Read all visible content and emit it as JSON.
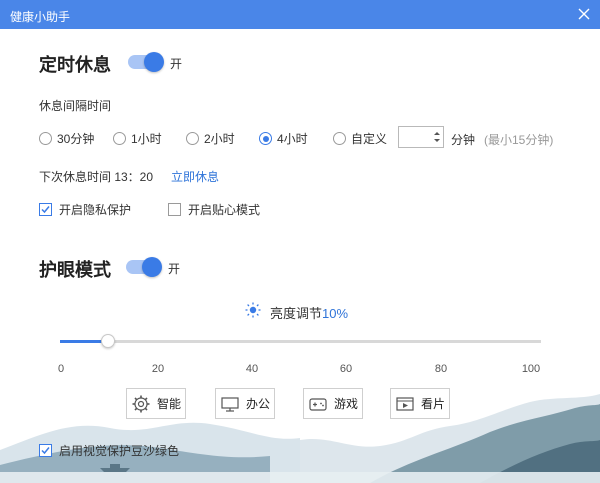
{
  "window": {
    "title": "健康小助手",
    "close_icon": "close-icon"
  },
  "timer": {
    "title": "定时休息",
    "toggle_state": "开",
    "toggle_on": true,
    "interval_label": "休息间隔时间",
    "options": [
      {
        "label": "30分钟",
        "checked": false
      },
      {
        "label": "1小时",
        "checked": false
      },
      {
        "label": "2小时",
        "checked": false
      },
      {
        "label": "4小时",
        "checked": true
      },
      {
        "label": "自定义",
        "checked": false
      }
    ],
    "custom_value": "",
    "custom_unit": "分钟",
    "custom_hint": "(最小15分钟)",
    "next_rest_label": "下次休息时间 13：20",
    "rest_now_link": "立即休息",
    "privacy_checkbox": {
      "label": "开启隐私保护",
      "checked": true
    },
    "caring_checkbox": {
      "label": "开启贴心模式",
      "checked": false
    }
  },
  "eye_care": {
    "title": "护眼模式",
    "toggle_state": "开",
    "toggle_on": true,
    "brightness_label": "亮度调节",
    "brightness_value": "10%",
    "brightness_level": 10,
    "ticks": [
      "0",
      "20",
      "40",
      "60",
      "80",
      "100"
    ],
    "modes": [
      {
        "label": "智能",
        "icon": "gear-icon"
      },
      {
        "label": "办公",
        "icon": "monitor-icon"
      },
      {
        "label": "游戏",
        "icon": "gamepad-icon"
      },
      {
        "label": "看片",
        "icon": "film-icon"
      }
    ],
    "bean_green_checkbox": {
      "label": "启用视觉保护豆沙绿色",
      "checked": true
    }
  },
  "colors": {
    "accent": "#3a7be6",
    "titlebar": "#4a86e8",
    "link": "#2f74d9"
  }
}
